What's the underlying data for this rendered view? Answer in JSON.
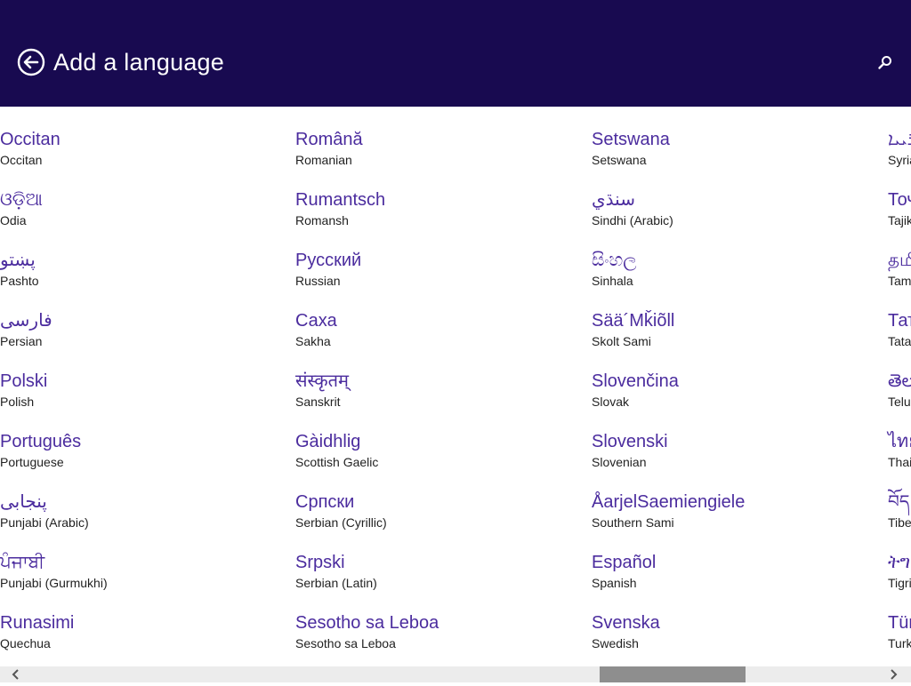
{
  "header": {
    "title": "Add a language",
    "back_icon": "back-arrow-circle-icon",
    "search_icon": "search-icon",
    "background_color": "#180a50"
  },
  "accent_color": "#4b2c9e",
  "columns": [
    {
      "items": [
        {
          "native": "Occitan",
          "english": "Occitan"
        },
        {
          "native": "ଓଡ଼ିଆ",
          "english": "Odia"
        },
        {
          "native": "پښتو",
          "english": "Pashto"
        },
        {
          "native": "فارسی",
          "english": "Persian"
        },
        {
          "native": "Polski",
          "english": "Polish"
        },
        {
          "native": "Português",
          "english": "Portuguese"
        },
        {
          "native": "پنجابی",
          "english": "Punjabi (Arabic)"
        },
        {
          "native": "ਪੰਜਾਬੀ",
          "english": "Punjabi (Gurmukhi)"
        },
        {
          "native": "Runasimi",
          "english": "Quechua"
        }
      ]
    },
    {
      "items": [
        {
          "native": "Română",
          "english": "Romanian"
        },
        {
          "native": "Rumantsch",
          "english": "Romansh"
        },
        {
          "native": "Русский",
          "english": "Russian"
        },
        {
          "native": "Саха",
          "english": "Sakha"
        },
        {
          "native": "संस्कृतम्",
          "english": "Sanskrit"
        },
        {
          "native": "Gàidhlig",
          "english": "Scottish Gaelic"
        },
        {
          "native": "Српски",
          "english": "Serbian (Cyrillic)"
        },
        {
          "native": "Srpski",
          "english": "Serbian (Latin)"
        },
        {
          "native": "Sesotho sa Leboa",
          "english": "Sesotho sa Leboa"
        }
      ]
    },
    {
      "items": [
        {
          "native": "Setswana",
          "english": "Setswana"
        },
        {
          "native": "سنڌي",
          "english": "Sindhi (Arabic)"
        },
        {
          "native": "සිංහල",
          "english": "Sinhala"
        },
        {
          "native": "Sää´Mǩiõll",
          "english": "Skolt Sami"
        },
        {
          "native": "Slovenčina",
          "english": "Slovak"
        },
        {
          "native": "Slovenski",
          "english": "Slovenian"
        },
        {
          "native": "ÅarjelSaemiengiele",
          "english": "Southern Sami"
        },
        {
          "native": "Español",
          "english": "Spanish"
        },
        {
          "native": "Svenska",
          "english": "Swedish"
        }
      ]
    },
    {
      "items": [
        {
          "native": "ܣܘܪܝܝܐ",
          "english": "Syria"
        },
        {
          "native": "Тоҷ",
          "english": "Tajik"
        },
        {
          "native": "தமி",
          "english": "Tam"
        },
        {
          "native": "Тат",
          "english": "Tata"
        },
        {
          "native": "తెలు",
          "english": "Telu"
        },
        {
          "native": "ไทย",
          "english": "Thai"
        },
        {
          "native": "བོད",
          "english": "Tibe"
        },
        {
          "native": "ትግ",
          "english": "Tigri"
        },
        {
          "native": "Tür",
          "english": "Turk"
        }
      ]
    }
  ],
  "scrollbar": {
    "left_icon": "chevron-left-icon",
    "right_icon": "chevron-right-icon",
    "position_fraction": 0.66
  }
}
